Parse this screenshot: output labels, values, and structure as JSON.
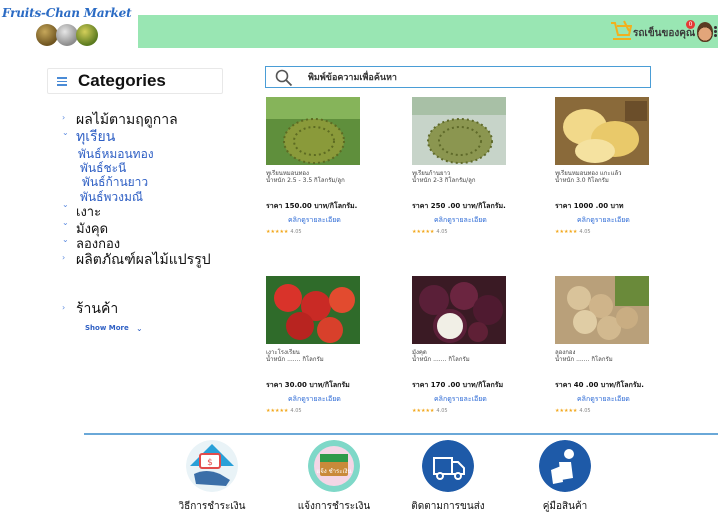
{
  "header": {
    "logo_text": "Fruits-Chan Market",
    "cart_label": "รถเข็นของคุณ",
    "cart_count": "0",
    "colors": {
      "header_bar": "#99e6b3",
      "accent": "#2e6bd6"
    }
  },
  "sidebar": {
    "title": "Categories",
    "items": [
      {
        "label": "ผลไม้ตามฤดูกาล",
        "level": 0
      },
      {
        "label": "ทุเรียน",
        "level": 0,
        "expanded": true
      },
      {
        "label": "พันธ์หมอนทอง",
        "level": 1
      },
      {
        "label": "พันธ์ชะนี",
        "level": 1
      },
      {
        "label": "พันธ์ก้านยาว",
        "level": 1
      },
      {
        "label": "พันธ์พวงมณี",
        "level": 1
      },
      {
        "label": "เงาะ",
        "level": 0
      },
      {
        "label": "มังคุด",
        "level": 0
      },
      {
        "label": "ลองกอง",
        "level": 0
      },
      {
        "label": "ผลิตภัณฑ์ผลไม้แปรรูป",
        "level": 0
      },
      {
        "label": "ร้านค้า",
        "level": 0
      }
    ],
    "show_more": "Show More"
  },
  "search": {
    "placeholder": "พิมพ์ข้อความเพื่อค้นหา"
  },
  "products": [
    {
      "name": "ทุเรียนหมอนทอง",
      "weight": "น้ำหนัก 2.5 - 3.5 กิโลกรัม/ลูก",
      "price": "ราคา 150.00 บาท/กิโลกรัม.",
      "detail": "คลิกดูรายละเอียด",
      "stars": "★★★★★",
      "rating": "4.05",
      "image": "durian"
    },
    {
      "name": "ทุเรียนก้านยาว",
      "weight": "น้ำหนัก 2-3 กิโลกรัม/ลูก",
      "price": "ราคา 250 .00 บาท/กิโลกรัม.",
      "detail": "คลิกดูรายละเอียด",
      "stars": "★★★★★",
      "rating": "4.05",
      "image": "durian"
    },
    {
      "name": "ทุเรียนหมอนทอง แกะแล้ว",
      "weight": "น้ำหนัก 3.0 กิโลกรัม",
      "price": "ราคา 1000 .00 บาท",
      "detail": "คลิกดูรายละเอียด",
      "stars": "★★★★★",
      "rating": "4.05",
      "image": "durian-peeled"
    },
    {
      "name": "เงาะโรงเรียน",
      "weight": "น้ำหนัก ....... กิโลกรัม",
      "price": "ราคา 30.00 บาท/กิโลกรัม",
      "detail": "คลิกดูรายละเอียด",
      "stars": "★★★★★",
      "rating": "4.05",
      "image": "rambutan"
    },
    {
      "name": "มังคุด",
      "weight": "น้ำหนัก ....... กิโลกรัม",
      "price": "ราคา 170 .00 บาท/กิโลกรัม",
      "detail": "คลิกดูรายละเอียด",
      "stars": "★★★★★",
      "rating": "4.05",
      "image": "mangosteen"
    },
    {
      "name": "ลองกอง",
      "weight": "น้ำหนัก ....... กิโลกรัม",
      "price": "ราคา 40 .00 บาท/กิโลกรัม.",
      "detail": "คลิกดูรายละเอียด",
      "stars": "★★★★★",
      "rating": "4.05",
      "image": "longkong"
    }
  ],
  "footer": {
    "features": [
      {
        "label": "วิธีการชำระเงิน",
        "icon": "payment-method-icon"
      },
      {
        "label": "แจ้งการชำระเงิน",
        "icon": "payment-notify-icon",
        "icon_text": "แจ้ง ชำระเงิน"
      },
      {
        "label": "ติดตามการขนส่ง",
        "icon": "delivery-truck-icon"
      },
      {
        "label": "คู่มือสินค้า",
        "icon": "product-manual-icon"
      }
    ]
  }
}
